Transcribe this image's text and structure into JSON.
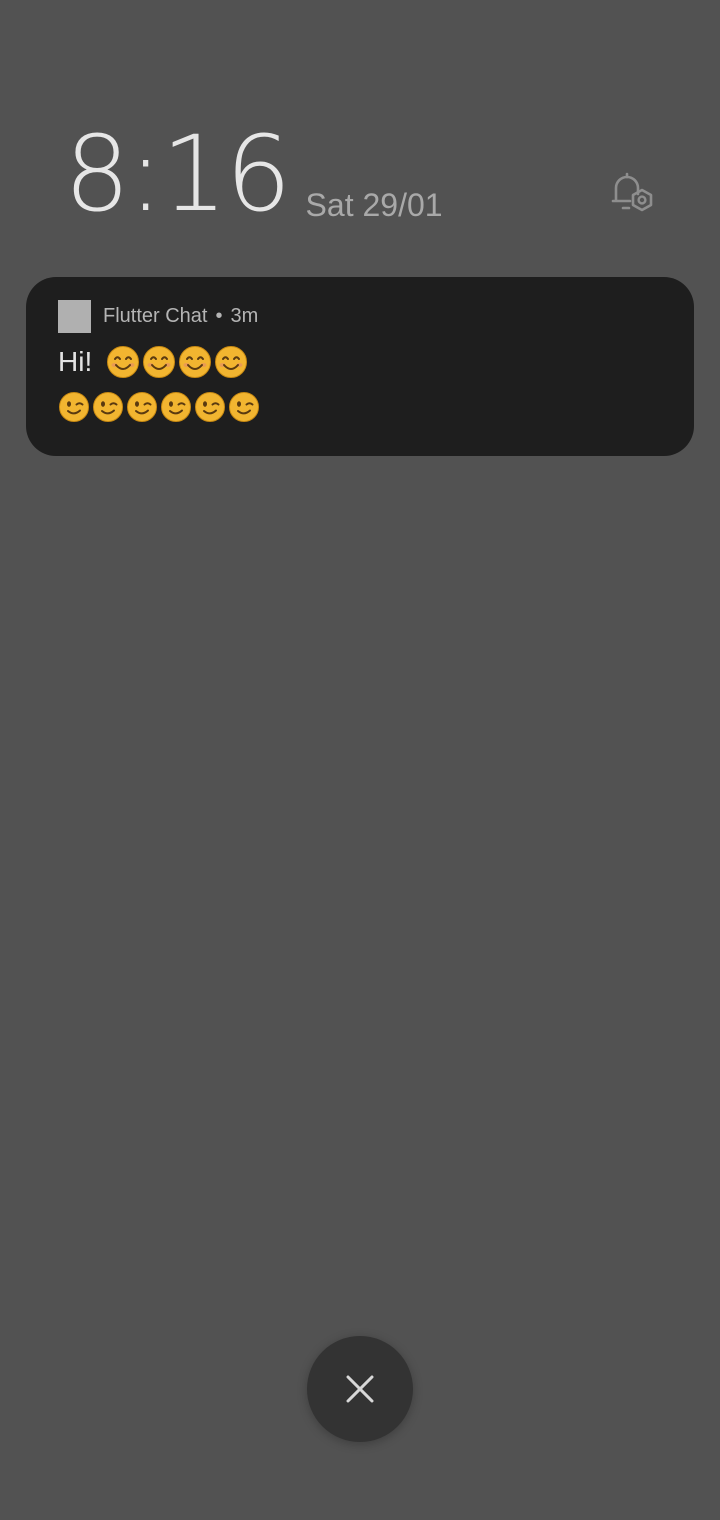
{
  "lockscreen": {
    "time": "8:16",
    "date": "Sat 29/01",
    "alarm_icon": "alarm-bell-settings-icon"
  },
  "notification": {
    "app_name": "Flutter Chat",
    "separator": "•",
    "time_ago": "3m",
    "title": "Hi!",
    "title_emojis": [
      "smiling-face-emoji",
      "smiling-face-emoji",
      "smiling-face-emoji",
      "smiling-face-emoji"
    ],
    "body_emojis": [
      "winking-face-emoji",
      "winking-face-emoji",
      "winking-face-emoji",
      "winking-face-emoji",
      "winking-face-emoji",
      "winking-face-emoji"
    ]
  },
  "dismiss": {
    "icon": "close-icon"
  },
  "colors": {
    "background": "#525252",
    "card": "#1e1e1e",
    "emoji_face": "#f2b530"
  }
}
